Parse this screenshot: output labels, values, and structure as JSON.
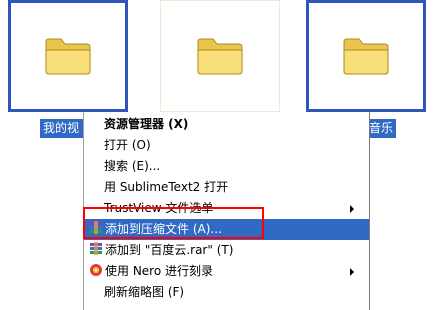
{
  "desktop": {
    "folders": [
      {
        "label": "我的视",
        "icon": "folder-icon",
        "selected": true
      },
      {
        "label": "",
        "icon": "folder-icon",
        "selected": false
      },
      {
        "label": "音乐",
        "icon": "folder-icon",
        "selected": true
      }
    ]
  },
  "context_menu": {
    "items": [
      {
        "label": "资源管理器 (X)",
        "bold": true
      },
      {
        "label": "打开 (O)"
      },
      {
        "label": "搜索 (E)..."
      },
      {
        "label": "用 SublimeText2 打开"
      },
      {
        "label": "TrustView 文件选单",
        "submenu": true
      },
      {
        "label": "添加到压缩文件 (A)...",
        "icon": "winrar-icon",
        "highlight": true
      },
      {
        "label": "添加到 \"百度云.rar\" (T)",
        "icon": "winrar-icon"
      },
      {
        "label": "使用 Nero 进行刻录",
        "icon": "nero-icon",
        "submenu": true
      },
      {
        "label": "刷新缩略图 (F)"
      }
    ]
  },
  "colors": {
    "selection_blue": "#316ac5",
    "tile_border_blue": "#2d56b8",
    "annotation_red": "#ff0000"
  }
}
